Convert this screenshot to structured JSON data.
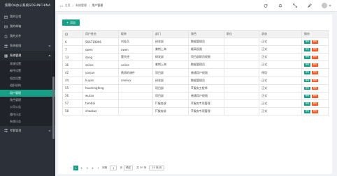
{
  "sidebar": {
    "logo": "紫荆OA办公系统SOSUNCHINA",
    "items": [
      {
        "label": "我的日程"
      },
      {
        "label": "我的邮箱"
      },
      {
        "label": "我的文件"
      },
      {
        "label": "系统权限"
      },
      {
        "label": "系统管理"
      }
    ],
    "sub_items": [
      {
        "label": "常规设置"
      },
      {
        "label": "邮件设置"
      },
      {
        "label": "短信设置"
      },
      {
        "label": "组织机构"
      },
      {
        "label": "用户管理"
      },
      {
        "label": "角色管理"
      },
      {
        "label": "公司公告"
      },
      {
        "label": "操作日志"
      },
      {
        "label": "系统日志"
      }
    ],
    "bottom_item": {
      "label": "考勤管理"
    }
  },
  "breadcrumb": {
    "home": "主页",
    "section": "系统管理",
    "current": "用户管理"
  },
  "toolbar": {
    "add_label": "添加"
  },
  "table": {
    "headers": [
      "ID",
      "用户姓名",
      "昵称",
      "部门",
      "角色",
      "职位",
      "状态",
      "操作"
    ],
    "rows": [
      {
        "id": "6",
        "name": "566719896",
        "nick": "刘金兵",
        "dept": "研发部",
        "role": "数据管理员",
        "title": "",
        "status": "正式"
      },
      {
        "id": "7",
        "name": "owen",
        "nick": "owen",
        "dept": "紫荆上海",
        "role": "最高权限",
        "title": "",
        "status": "正式"
      },
      {
        "id": "13",
        "name": "dong",
        "nick": "董天经",
        "dept": "研发部",
        "role": "项目部职员权限",
        "title": "",
        "status": "正式"
      },
      {
        "id": "36",
        "name": "soline",
        "nick": "soline",
        "dept": "紫荆上海",
        "role": "数据管理员",
        "title": "",
        "status": "正式"
      },
      {
        "id": "42",
        "name": "yanjun",
        "nick": "燕郊的课件",
        "dept": "项目部",
        "role": "普通用户权限",
        "title": "",
        "status": "停用"
      },
      {
        "id": "44",
        "name": "liuyan",
        "nick": "oneliux",
        "dept": "研发部",
        "role": "数据管理员",
        "title": "",
        "status": "正式"
      },
      {
        "id": "55",
        "name": "houmingfeng",
        "nick": "",
        "dept": "项目部",
        "role": "IT服务工程师",
        "title": "",
        "status": "正式"
      },
      {
        "id": "56",
        "name": "wutao",
        "nick": "",
        "dept": "项目部",
        "role": "普通用户权限",
        "title": "",
        "status": "正式"
      },
      {
        "id": "57",
        "name": "tambai",
        "nick": "",
        "dept": "IT服务部",
        "role": "IT服务专项管理",
        "title": "",
        "status": "正式"
      },
      {
        "id": "58",
        "name": "shaokun",
        "nick": "",
        "dept": "IT服务部",
        "role": "IT服务专项管理",
        "title": "",
        "status": "正式"
      }
    ],
    "edit_label": "编辑",
    "delete_label": "删除"
  },
  "pager": {
    "pages": [
      "1",
      "2",
      "3",
      "4"
    ],
    "goto_label": "到第",
    "goto_value": "1",
    "page_unit": "页",
    "confirm_label": "确定",
    "total_label": "共 30 条",
    "per_page": "10 条/页"
  },
  "colors": {
    "accent": "#16a085",
    "danger": "#ff5722",
    "sidebar_bg": "#2c3038"
  }
}
